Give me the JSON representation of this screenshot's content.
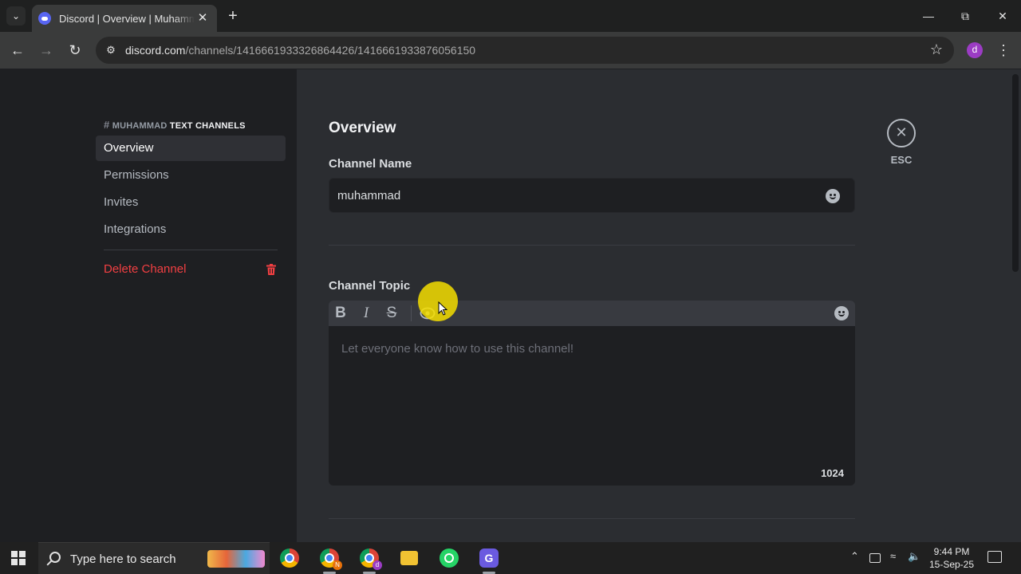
{
  "browser": {
    "tab_title": "Discord | Overview | Muhammad",
    "tab_list_icon": "chevron-down-icon",
    "new_tab_label": "+",
    "url_host": "discord.com",
    "url_path": "/channels/1416661933326864426/1416661933876056150",
    "profile_initial": "d",
    "profile_color": "#9b3cc4"
  },
  "sidebar": {
    "hash": "#",
    "channel": "MUHAMMAD",
    "category": "TEXT CHANNELS",
    "items": [
      {
        "label": "Overview",
        "active": true
      },
      {
        "label": "Permissions",
        "active": false
      },
      {
        "label": "Invites",
        "active": false
      },
      {
        "label": "Integrations",
        "active": false
      }
    ],
    "delete_label": "Delete Channel"
  },
  "main": {
    "title": "Overview",
    "channel_name_label": "Channel Name",
    "channel_name_value": "muhammad",
    "channel_topic_label": "Channel Topic",
    "topic_toolbar": [
      "B",
      "I",
      "S"
    ],
    "topic_placeholder": "Let everyone know how to use this channel!",
    "char_count": "1024",
    "close_label": "ESC"
  },
  "taskbar": {
    "search_placeholder": "Type here to search",
    "time": "9:44 PM",
    "date": "15-Sep-25"
  },
  "colors": {
    "accent": "#5865f2",
    "danger": "#f23f42",
    "cursor_highlight": "#f5de00"
  }
}
